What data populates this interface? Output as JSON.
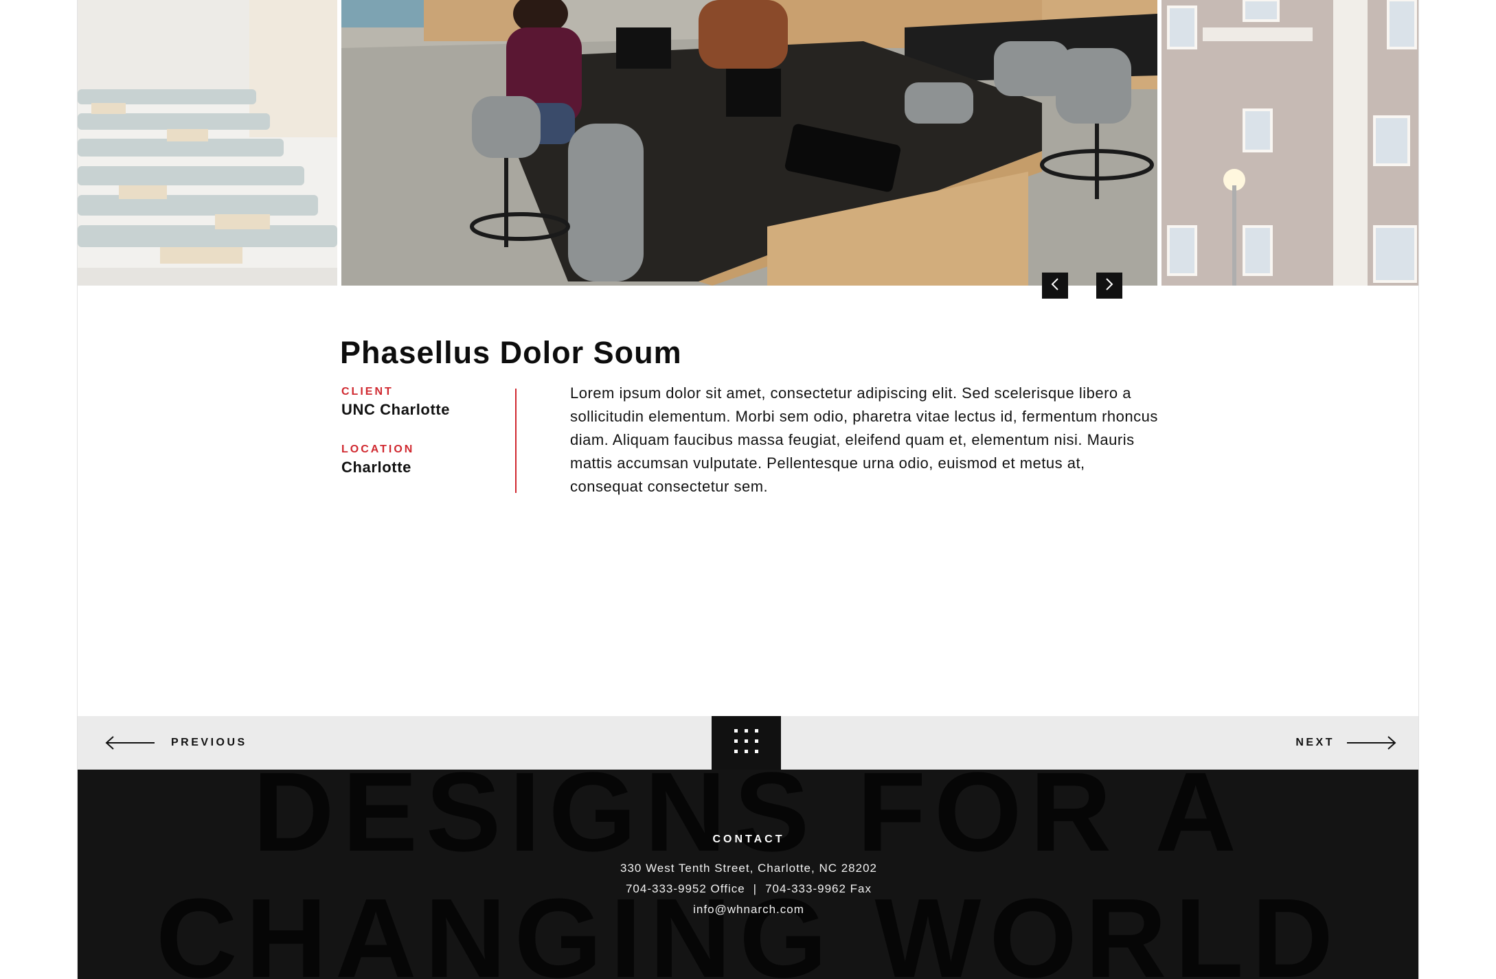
{
  "gallery": {
    "prev_slide_label": "previous slide",
    "next_slide_label": "next slide"
  },
  "project": {
    "title": "Phasellus Dolor Soum",
    "client_label": "CLIENT",
    "client_value": "UNC Charlotte",
    "location_label": "LOCATION",
    "location_value": "Charlotte",
    "description": "Lorem ipsum dolor sit amet, consectetur adipiscing elit. Sed scelerisque libero a sollicitudin elementum. Morbi sem odio, pharetra vitae lectus id, fermentum rhoncus diam. Aliquam faucibus massa feugiat, eleifend quam et, elementum nisi. Mauris mattis accumsan vulputate. Pellentesque urna odio, euismod et metus at, consequat consectetur sem."
  },
  "pager": {
    "previous_label": "PREVIOUS",
    "next_label": "NEXT"
  },
  "footer": {
    "bg_line1": "DESIGNS FOR A",
    "bg_line2": "CHANGING WORLD",
    "contact_heading": "CONTACT",
    "address": "330 West Tenth Street, Charlotte, NC 28202",
    "office_phone": "704-333-9952 Office",
    "separator": "|",
    "fax": "704-333-9962 Fax",
    "email": "info@whnarch.com"
  },
  "colors": {
    "accent": "#d0282f",
    "dark": "#111111",
    "pager_bg": "#ebebeb",
    "footer_bg": "#141414"
  },
  "icons": {
    "gallery_prev": "chevron-left-icon",
    "gallery_next": "chevron-right-icon",
    "pager_prev": "arrow-left-icon",
    "pager_next": "arrow-right-icon",
    "grid": "grid-dots-icon"
  }
}
